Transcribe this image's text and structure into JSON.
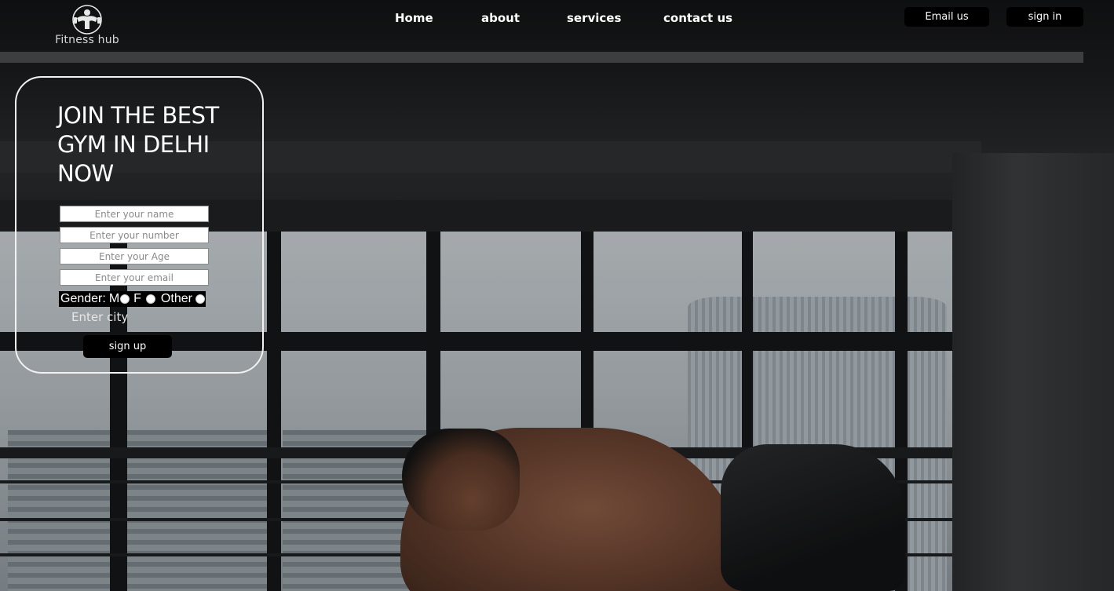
{
  "brand": {
    "name": "Fitness hub",
    "logo_icon": "bodybuilder-icon"
  },
  "nav": {
    "items": [
      {
        "label": "Home"
      },
      {
        "label": "about"
      },
      {
        "label": "services"
      },
      {
        "label": "contact us"
      }
    ]
  },
  "header_actions": {
    "email_label": "Email us",
    "signin_label": "sign in"
  },
  "hero": {
    "headline": "JOIN THE BEST GYM IN DELHI NOW"
  },
  "form": {
    "name_placeholder": "Enter your name",
    "number_placeholder": "Enter your number",
    "age_placeholder": "Enter your Age",
    "email_placeholder": "Enter your email",
    "gender_label": "Gender:",
    "gender_options": [
      "M",
      "F",
      "Other"
    ],
    "city_label": "Enter city",
    "submit_label": "sign up"
  },
  "colors": {
    "button_bg": "#000000",
    "card_border": "#f2f2f2",
    "text": "#ffffff"
  }
}
